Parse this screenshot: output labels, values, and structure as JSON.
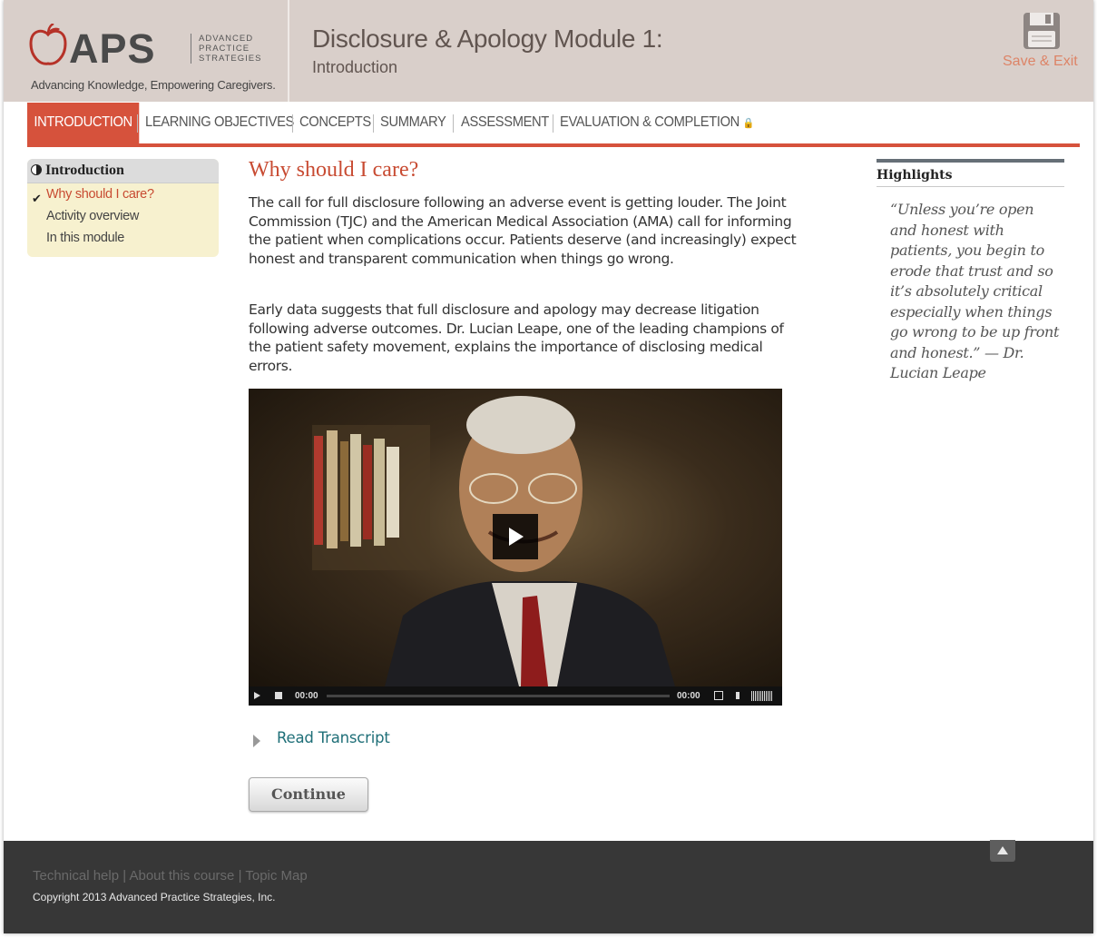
{
  "brand": {
    "logo_letters": "APS",
    "logo_sub": [
      "ADVANCED",
      "PRACTICE",
      "STRATEGIES"
    ],
    "tagline": "Advancing Knowledge, Empowering Caregivers."
  },
  "header": {
    "title": "Disclosure & Apology Module 1:",
    "subtitle": "Introduction",
    "save_exit_label": "Save & Exit"
  },
  "nav": {
    "items": [
      {
        "label": "INTRODUCTION",
        "active": true
      },
      {
        "label": "LEARNING OBJECTIVES"
      },
      {
        "label": "CONCEPTS"
      },
      {
        "label": "SUMMARY"
      },
      {
        "label": "ASSESSMENT"
      },
      {
        "label": "EVALUATION & COMPLETION",
        "locked": true
      }
    ]
  },
  "sidebar": {
    "heading": "Introduction",
    "items": [
      {
        "label": "Why should I care?",
        "current": true,
        "completed": true
      },
      {
        "label": "Activity overview"
      },
      {
        "label": "In this module"
      }
    ]
  },
  "main": {
    "title": "Why should I care?",
    "paragraphs": [
      "The call for full disclosure following an adverse event is getting louder. The Joint Commission (TJC) and the American Medical Association (AMA) call for informing the patient when complications occur. Patients deserve (and increasingly) expect honest and transparent communication when things go wrong.",
      "Early data suggests that full disclosure and apology may decrease litigation following adverse outcomes. Dr. Lucian Leape, one of the leading champions of the patient safety movement, explains the importance of disclosing medical errors."
    ],
    "video": {
      "time_current": "00:00",
      "time_total": "00:00",
      "progress": 0
    },
    "read_transcript_label": "Read Transcript",
    "continue_label": "Continue"
  },
  "highlights": {
    "title": "Highlights",
    "quote": "“Unless you’re open and honest with patients, you begin to erode that trust and so it’s absolutely critical especially when things go wrong to be up front and honest.” — Dr. Lucian Leape"
  },
  "footer": {
    "links": [
      "Technical help",
      "About this course",
      "Topic Map"
    ],
    "separator": "|",
    "copyright": "Copyright 2013 Advanced Practice Strategies, Inc."
  },
  "colors": {
    "accent": "#d6523c",
    "header_bg": "#d9cfca",
    "sidebar_bg": "#f7f1cf",
    "link": "#1f6f78",
    "footer_bg": "#373737"
  }
}
